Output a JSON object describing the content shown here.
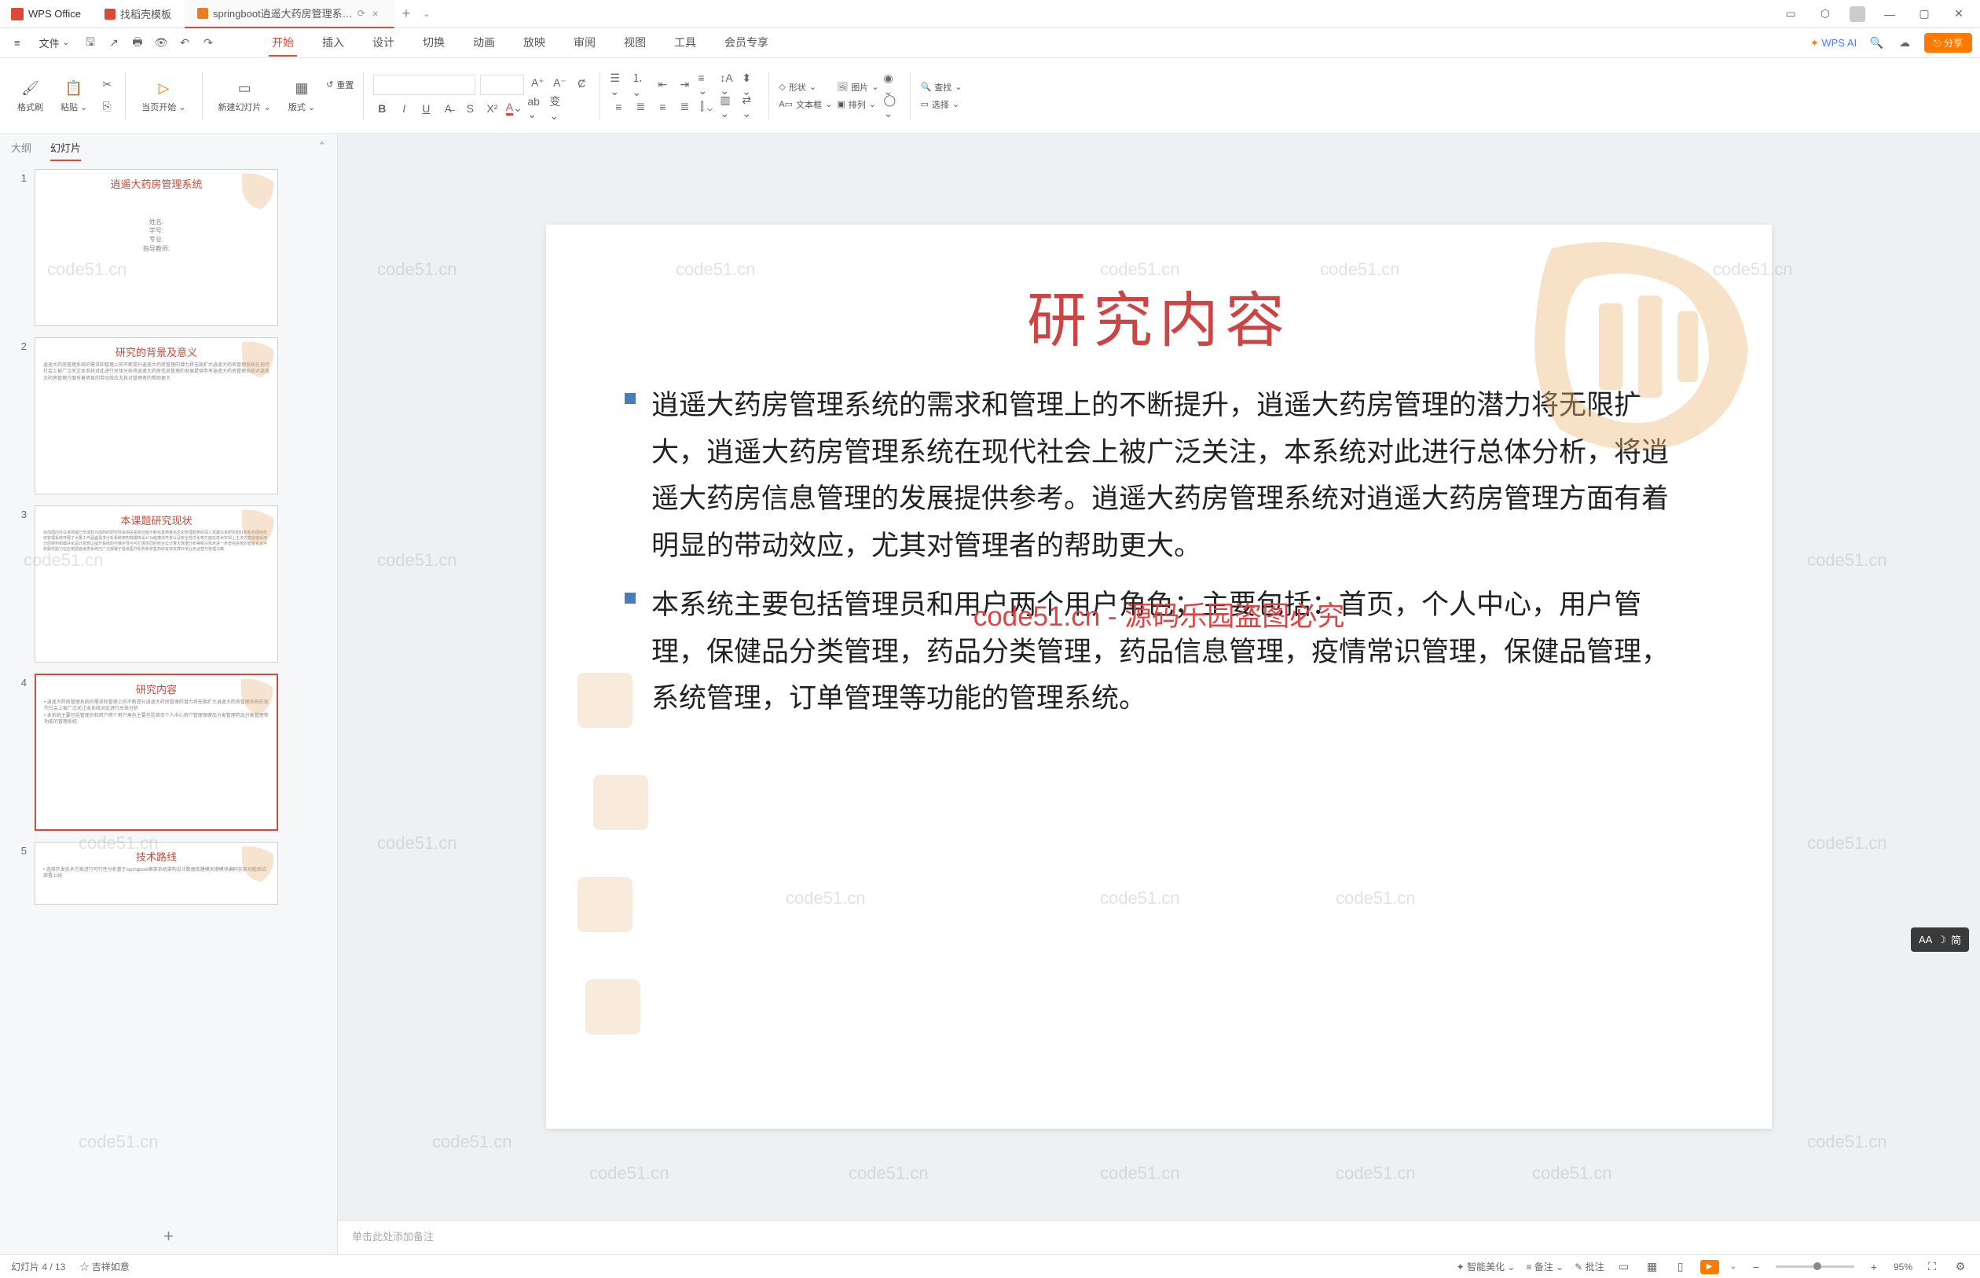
{
  "titlebar": {
    "app_name": "WPS Office",
    "tabs": [
      {
        "label": "找稻壳模板",
        "active": false
      },
      {
        "label": "springboot逍遥大药房管理系…",
        "active": true
      }
    ]
  },
  "menubar": {
    "file": "文件",
    "tabs": [
      "开始",
      "插入",
      "设计",
      "切换",
      "动画",
      "放映",
      "审阅",
      "视图",
      "工具",
      "会员专享"
    ],
    "active_tab": "开始",
    "wps_ai": "WPS AI",
    "share": "分享"
  },
  "ribbon": {
    "format_brush": "格式刷",
    "paste": "粘贴",
    "from_current": "当页开始",
    "new_slide": "新建幻灯片",
    "layout": "版式",
    "reset": "重置",
    "font_placeholder": "",
    "shape": "形状",
    "picture": "图片",
    "textbox": "文本框",
    "arrange": "排列",
    "find": "查找",
    "select": "选择"
  },
  "left_panel": {
    "tab_outline": "大纲",
    "tab_slides": "幻灯片",
    "thumbs": [
      {
        "num": "1",
        "title": "逍遥大药房管理系统",
        "sub": "姓名:\n学号:\n专业:\n指导教师:"
      },
      {
        "num": "2",
        "title": "研究的背景及意义"
      },
      {
        "num": "3",
        "title": "本课题研究现状"
      },
      {
        "num": "4",
        "title": "研究内容"
      },
      {
        "num": "5",
        "title": "技术路线"
      }
    ],
    "active_thumb": 3
  },
  "slide": {
    "title": "研究内容",
    "bullets": [
      "逍遥大药房管理系统的需求和管理上的不断提升，逍遥大药房管理的潜力将无限扩大，逍遥大药房管理系统在现代社会上被广泛关注，本系统对此进行总体分析，将逍遥大药房信息管理的发展提供参考。逍遥大药房管理系统对逍遥大药房管理方面有着明显的带动效应，尤其对管理者的帮助更大。",
      "本系统主要包括管理员和用户两个用户角色；主要包括：首页，个人中心，用户管理，保健品分类管理，药品分类管理，药品信息管理，疫情常识管理，保健品管理，系统管理，订单管理等功能的管理系统。"
    ],
    "watermark_center": "code51.cn - 源码乐园盗图必究",
    "watermark_text": "code51.cn"
  },
  "notes": {
    "placeholder": "单击此处添加备注"
  },
  "statusbar": {
    "slide_counter": "幻灯片 4 / 13",
    "theme": "吉祥如意",
    "smart_beautify": "智能美化",
    "notes_btn": "备注",
    "review_btn": "批注",
    "zoom": "95%"
  },
  "float_toggle": {
    "label": "简",
    "aa": "AA"
  }
}
